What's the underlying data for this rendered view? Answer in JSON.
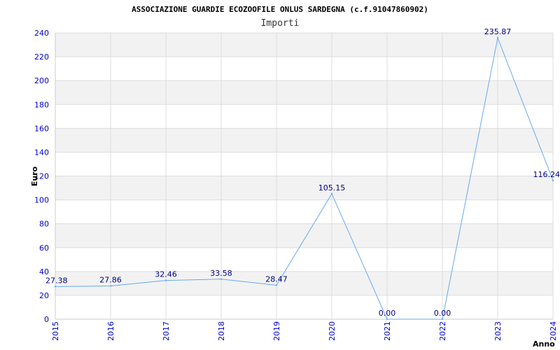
{
  "chart_data": {
    "type": "line",
    "title": "ASSOCIAZIONE GUARDIE ECOZOOFILE ONLUS SARDEGNA (c.f.91047860902)",
    "subtitle": "Importi",
    "xlabel": "Anno",
    "ylabel": "Euro",
    "categories": [
      "2015",
      "2016",
      "2017",
      "2018",
      "2019",
      "2020",
      "2021",
      "2022",
      "2023",
      "2024"
    ],
    "values": [
      27.38,
      27.86,
      32.46,
      33.58,
      28.47,
      105.15,
      0.0,
      0.0,
      235.87,
      116.24
    ],
    "data_labels": [
      "27.38",
      "27.86",
      "32.46",
      "33.58",
      "28.47",
      "105.15",
      "0.00",
      "0.00",
      "235.87",
      "116.24"
    ],
    "ylim": [
      0,
      240
    ],
    "yticks": [
      "0",
      "20",
      "40",
      "60",
      "80",
      "100",
      "120",
      "140",
      "160",
      "180",
      "200",
      "220",
      "240"
    ],
    "grid": true,
    "colors": {
      "line": "#66aaee",
      "band": "#f2f2f2",
      "grid": "#dddddd",
      "tick": "#0000cc",
      "data_label": "#000080"
    }
  }
}
